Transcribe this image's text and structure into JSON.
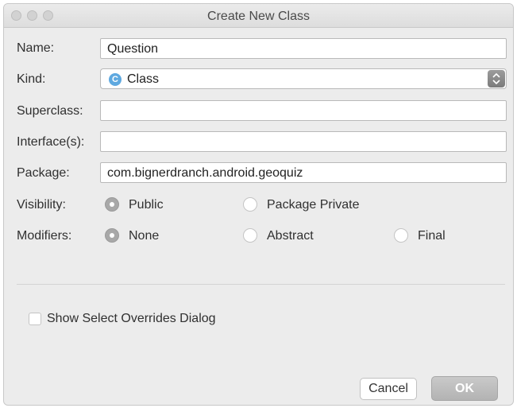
{
  "window": {
    "title": "Create New Class"
  },
  "form": {
    "name": {
      "label": "Name:",
      "value": "Question"
    },
    "kind": {
      "label": "Kind:",
      "value": "Class",
      "icon": "class-icon",
      "icon_glyph": "C"
    },
    "superclass": {
      "label": "Superclass:",
      "value": ""
    },
    "interfaces": {
      "label": "Interface(s):",
      "value": ""
    },
    "package": {
      "label": "Package:",
      "value": "com.bignerdranch.android.geoquiz"
    },
    "visibility": {
      "label": "Visibility:",
      "options": [
        {
          "label": "Public",
          "checked": true
        },
        {
          "label": "Package Private",
          "checked": false
        }
      ]
    },
    "modifiers": {
      "label": "Modifiers:",
      "options": [
        {
          "label": "None",
          "checked": true
        },
        {
          "label": "Abstract",
          "checked": false
        },
        {
          "label": "Final",
          "checked": false
        }
      ]
    },
    "show_overrides": {
      "label": "Show Select Overrides Dialog",
      "checked": false
    }
  },
  "buttons": {
    "cancel": "Cancel",
    "ok": "OK"
  }
}
